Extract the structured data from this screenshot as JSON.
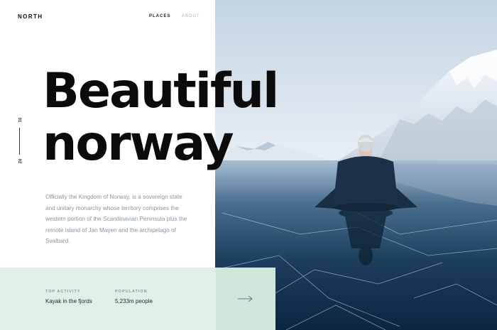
{
  "header": {
    "brand": "NORTH",
    "nav": {
      "places": "PLACES",
      "about": "ABOUT"
    }
  },
  "hero": {
    "headline_line1": "Beautiful",
    "headline_line2": "norway",
    "description": "Officially the Kingdom of Norway, is a sovereign state and unitary monarchy whose territory comprises the western portion of the Scandinavian Peninsula plus the remote island of Jan Mayen and the archipelago of Svalbard."
  },
  "pager": {
    "current": "01",
    "total": "02"
  },
  "stats": [
    {
      "label": "TOP ACTIVITY",
      "value": "Kayak in the fjords"
    },
    {
      "label": "POPULATION",
      "value": "5,233m people"
    }
  ],
  "next_icon": "arrow-right-icon",
  "colors": {
    "headline": "#0b0b0b",
    "body_text": "#8895a2",
    "info_bar": "#dff0e6",
    "next_button": "#cfe7db",
    "nav_active": "#222222",
    "nav_inactive": "#a8b3bd"
  },
  "photo": {
    "subject": "person sitting on frozen lake with snowy mountains"
  }
}
